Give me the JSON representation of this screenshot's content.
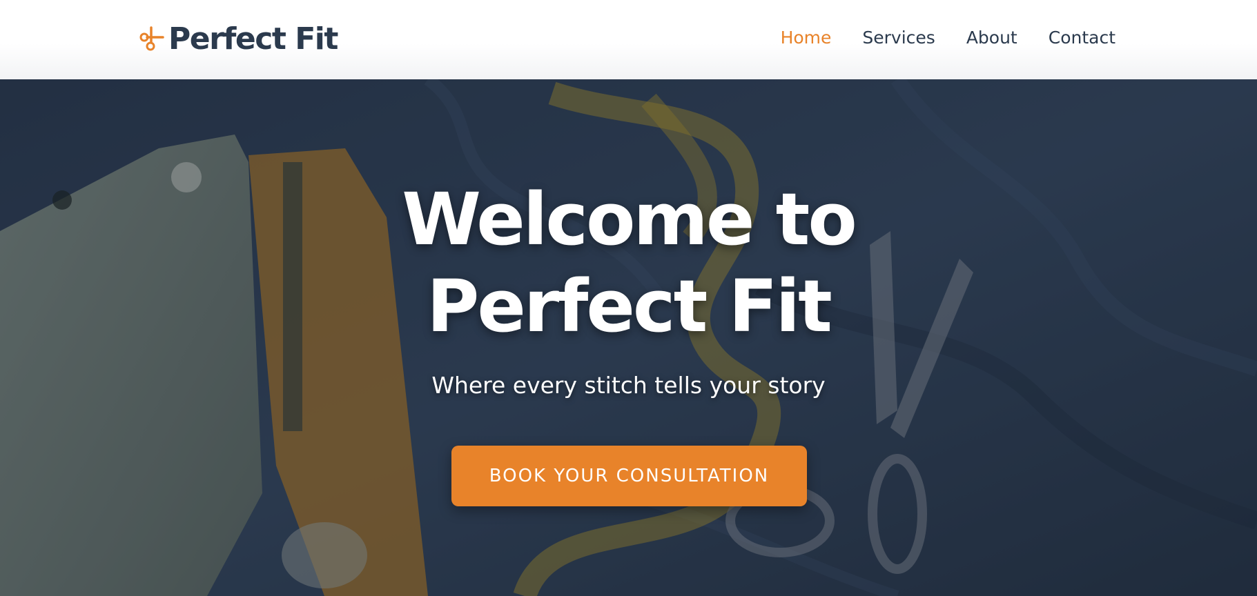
{
  "brand": {
    "name": "Perfect Fit",
    "icon": "scissors-icon",
    "accent_color": "#e8832a",
    "text_color": "#2b3a4d"
  },
  "nav": {
    "items": [
      {
        "label": "Home",
        "active": true
      },
      {
        "label": "Services",
        "active": false
      },
      {
        "label": "About",
        "active": false
      },
      {
        "label": "Contact",
        "active": false
      }
    ]
  },
  "hero": {
    "title_line1": "Welcome to",
    "title_line2": "Perfect Fit",
    "subtitle": "Where every stitch tells your story",
    "cta_label": "BOOK YOUR CONSULTATION",
    "background": "sewing-machine-tape-measure-scissors-on-denim-photo"
  }
}
